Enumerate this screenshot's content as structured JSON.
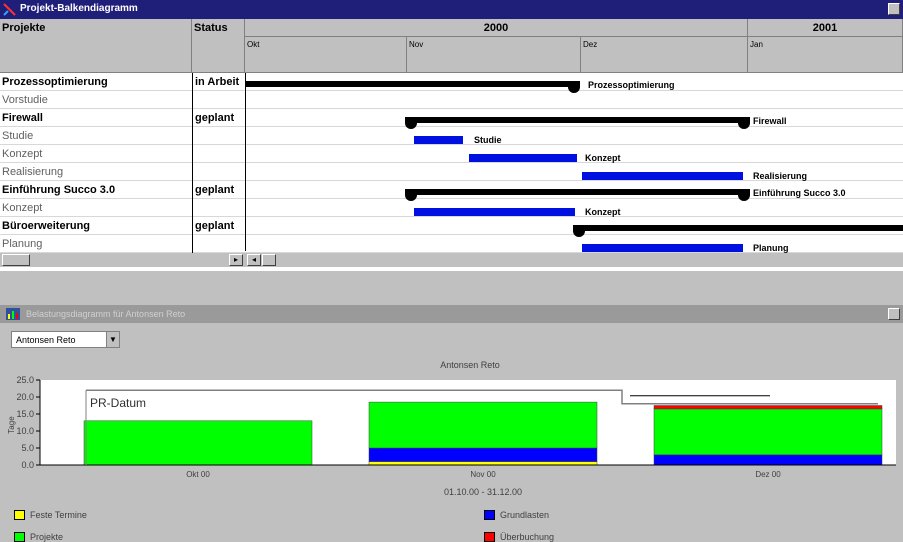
{
  "window": {
    "title": "Projekt-Balkendiagramm"
  },
  "table": {
    "col_projects": "Projekte",
    "col_status": "Status",
    "year_2000": "2000",
    "year_2001": "2001",
    "months": [
      "Okt",
      "Nov",
      "Dez",
      "Jan"
    ],
    "rows": [
      {
        "name": "Prozessoptimierung",
        "status": "in Arbeit",
        "bold": true
      },
      {
        "name": "Vorstudie",
        "status": "",
        "bold": false
      },
      {
        "name": "Firewall",
        "status": "geplant",
        "bold": true
      },
      {
        "name": "Studie",
        "status": "",
        "bold": false
      },
      {
        "name": "Konzept",
        "status": "",
        "bold": false
      },
      {
        "name": "Realisierung",
        "status": "",
        "bold": false
      },
      {
        "name": "Einführung Succo 3.0",
        "status": "geplant",
        "bold": true
      },
      {
        "name": "Konzept",
        "status": "",
        "bold": false
      },
      {
        "name": "Büroerweiterung",
        "status": "geplant",
        "bold": true
      },
      {
        "name": "Planung",
        "status": "",
        "bold": false
      }
    ],
    "bar_labels": [
      "Prozessoptimierung",
      "Firewall",
      "Studie",
      "Konzept",
      "Realisierung",
      "Einführung Succo 3.0",
      "Konzept",
      "Planung"
    ]
  },
  "lower_window": {
    "title": "Belastungsdiagramm für Antonsen Reto"
  },
  "person_select": {
    "value": "Antonsen Reto"
  },
  "chart_data": {
    "type": "bar",
    "title": "Antonsen Reto",
    "ylabel": "Tage",
    "xlabel": "01.10.00 - 31.12.00",
    "ylim": [
      0,
      25
    ],
    "yticks": [
      "25.0",
      "20.0",
      "15.0",
      "10.0",
      "5.0",
      "0.0"
    ],
    "categories": [
      "Okt 00",
      "Nov 00",
      "Dez 00"
    ],
    "series": [
      {
        "name": "Feste Termine",
        "color": "#ffff00",
        "values": [
          0,
          1.0,
          0
        ]
      },
      {
        "name": "Grundlasten",
        "color": "#0000ff",
        "values": [
          0,
          4.0,
          3.0
        ]
      },
      {
        "name": "Projekte",
        "color": "#00ff00",
        "values": [
          13.0,
          13.5,
          13.5
        ]
      },
      {
        "name": "Überbuchung",
        "color": "#ff0000",
        "values": [
          0,
          0,
          1.0
        ]
      }
    ],
    "capacity_line_label": "PR-Datum",
    "capacity_line": [
      22.0,
      22.0,
      18.0
    ],
    "legend_position": "bottom"
  }
}
